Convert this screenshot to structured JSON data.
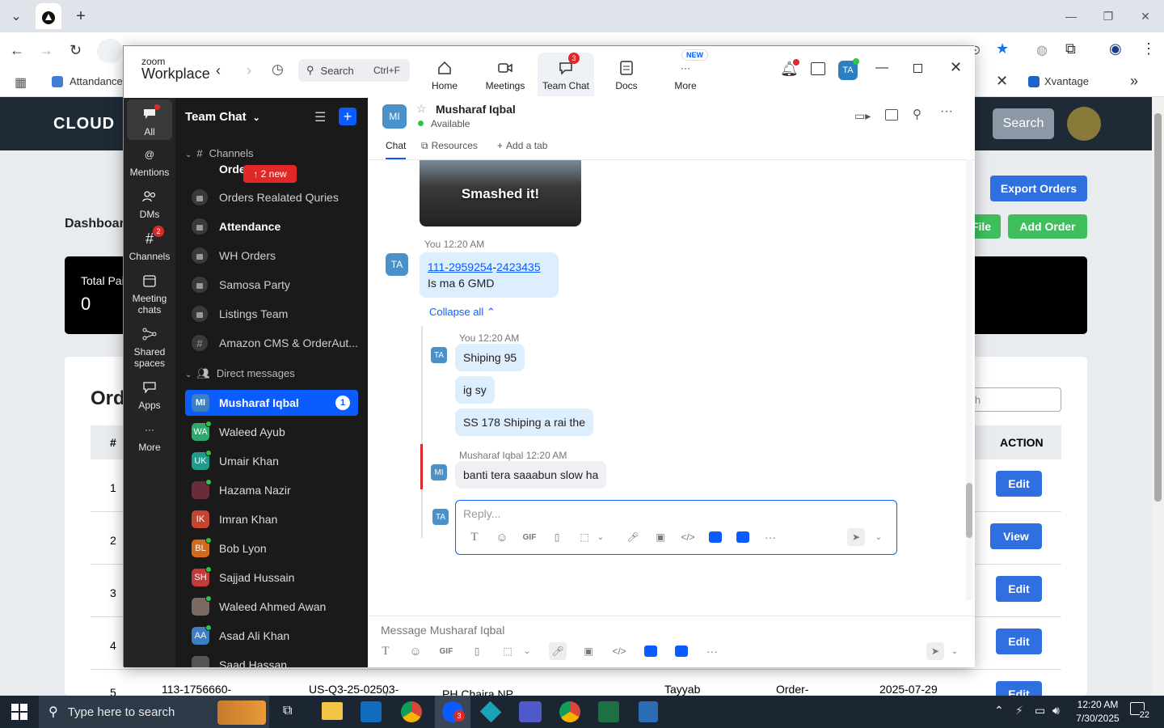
{
  "browser": {
    "bookmarks": [
      "Attandance",
      "Xvantage"
    ]
  },
  "web": {
    "logo": "CLOUD",
    "search_button": "Search",
    "title": "Dashboar",
    "total_label": "Total Pai",
    "total_value": "0",
    "orders_title": "Ord",
    "search_placeholder": "rch",
    "export_button": "Export Orders",
    "file_button": "File",
    "add_order_button": "Add Order",
    "table_head_hash": "#",
    "table_head_action": "ACTION",
    "rows": [
      {
        "num": "1",
        "action": "Edit"
      },
      {
        "num": "2",
        "action": "View"
      },
      {
        "num": "3",
        "action": "Edit"
      },
      {
        "num": "4",
        "action": "Edit"
      },
      {
        "num": "5",
        "action": "Edit"
      }
    ],
    "partial_row": [
      "113-1756660-",
      "US-Q3-25-02503-",
      "PH Chaira NP",
      "Tayyab",
      "Order-",
      "2025-07-29"
    ]
  },
  "zoom": {
    "brand_top": "zoom",
    "brand_bottom": "Workplace",
    "search_label": "Search",
    "search_shortcut": "Ctrl+F",
    "nav": [
      {
        "label": "Home"
      },
      {
        "label": "Meetings"
      },
      {
        "label": "Team Chat",
        "badge": "3"
      },
      {
        "label": "Docs"
      },
      {
        "label": "More",
        "badge": "NEW"
      }
    ],
    "profile_initials": "TA",
    "rail": [
      {
        "label": "All"
      },
      {
        "label": "Mentions"
      },
      {
        "label": "DMs"
      },
      {
        "label": "Channels",
        "badge": "2"
      },
      {
        "label": "Meeting chats"
      },
      {
        "label": "Shared spaces"
      },
      {
        "label": "Apps"
      },
      {
        "label": "More"
      }
    ],
    "list_title": "Team Chat",
    "channels_header": "Channels",
    "new_pill": "↑ 2 new",
    "channels": [
      {
        "name": "Orde... g la"
      },
      {
        "name": "Orders Realated Quries"
      },
      {
        "name": "Attendance"
      },
      {
        "name": "WH Orders"
      },
      {
        "name": "Samosa Party"
      },
      {
        "name": "Listings Team"
      },
      {
        "name": "Amazon CMS & OrderAut..."
      }
    ],
    "dm_header": "Direct messages",
    "dms": [
      {
        "initials": "MI",
        "name": "Musharaf Iqbal",
        "badge": "1",
        "color": "#3d7fc4"
      },
      {
        "initials": "WA",
        "name": "Waleed Ayub",
        "color": "#2fa86b"
      },
      {
        "initials": "UK",
        "name": "Umair Khan",
        "color": "#1f9a8c"
      },
      {
        "initials": "",
        "name": "Hazama Nazir",
        "color": "#6a2c3a"
      },
      {
        "initials": "IK",
        "name": "Imran Khan",
        "color": "#c4452f"
      },
      {
        "initials": "BL",
        "name": "Bob Lyon",
        "color": "#d46a1e"
      },
      {
        "initials": "SH",
        "name": "Sajjad Hussain",
        "color": "#c23a3a"
      },
      {
        "initials": "",
        "name": "Waleed Ahmed Awan",
        "color": "#7a6a60"
      },
      {
        "initials": "AA",
        "name": "Asad Ali Khan",
        "color": "#3d7fc4"
      },
      {
        "initials": "",
        "name": "Saad Hassan",
        "color": "#555555"
      }
    ],
    "chat": {
      "contact_initials": "MI",
      "contact_name": "Musharaf Iqbal",
      "status": "Available",
      "tabs": [
        "Chat",
        "Resources",
        "Add a tab"
      ],
      "image_caption": "Smashed it!",
      "msg1_meta": "You 12:20 AM",
      "msg1_avatar": "TA",
      "msg1_link_a": "111-2959254",
      "msg1_link_sep": "-",
      "msg1_link_b": "2423435",
      "msg1_line2": "Is ma 6 GMD",
      "collapse": "Collapse all ⌃",
      "thread_meta1": "You 12:20 AM",
      "thread_av": "TA",
      "thread_msgs": [
        "Shiping 95",
        "ig sy",
        "SS 178 Shiping a rai the"
      ],
      "thread_meta2": "Musharaf Iqbal 12:20 AM",
      "thread_av2": "MI",
      "thread_msg4": "banti tera saaabun slow ha",
      "reply_placeholder": "Reply...",
      "reply_av": "TA",
      "composer_placeholder": "Message Musharaf Iqbal",
      "gif": "GIF"
    }
  },
  "taskbar": {
    "search_placeholder": "Type here to search",
    "time": "12:20 AM",
    "date": "7/30/2025",
    "notif_count": "22",
    "zoom_badge": "3"
  }
}
